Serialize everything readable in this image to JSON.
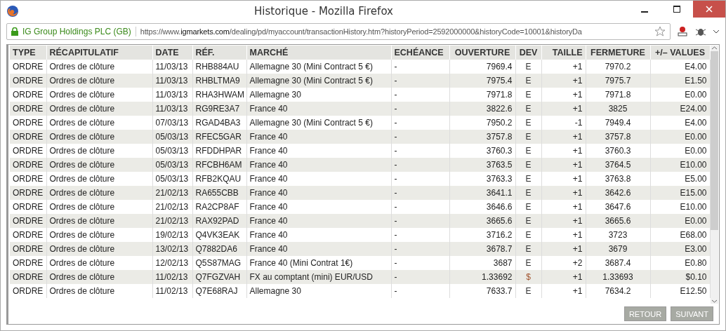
{
  "window": {
    "title": "Historique - Mozilla Firefox"
  },
  "address_bar": {
    "site_identity": "IG Group Holdings PLC (GB)",
    "url_prefix": "https://www.",
    "url_domain": "igmarkets.com",
    "url_path": "/dealing/pd/myaccount/transactionHistory.htm?historyPeriod=2592000000&historyCode=10001&historyDa"
  },
  "table": {
    "columns": [
      "TYPE",
      "RÉCAPITULATIF",
      "DATE",
      "RÉF.",
      "MARCHÉ",
      "ECHÉANCE",
      "OUVERTURE",
      "DEV",
      "TAILLE",
      "FERMETURE",
      "+/– VALUES"
    ],
    "rows": [
      {
        "cells": [
          "ORDRE",
          "Ordres de clôture",
          "11/03/13",
          "RHB884AU",
          "Allemagne 30 (Mini Contract 5 €)",
          "-",
          "7969.4",
          "E",
          "+1",
          "7970.2",
          "E4.00"
        ],
        "color": "#333333"
      },
      {
        "cells": [
          "ORDRE",
          "Ordres de clôture",
          "11/03/13",
          "RHBLTMA9",
          "Allemagne 30 (Mini Contract 5 €)",
          "-",
          "7975.4",
          "E",
          "+1",
          "7975.7",
          "E1.50"
        ],
        "color": "#333333"
      },
      {
        "cells": [
          "ORDRE",
          "Ordres de clôture",
          "11/03/13",
          "RHA3HWAM",
          "Allemagne 30",
          "-",
          "7971.8",
          "E",
          "+1",
          "7971.8",
          "E0.00"
        ],
        "color": "#333333"
      },
      {
        "cells": [
          "ORDRE",
          "Ordres de clôture",
          "11/03/13",
          "RG9RE3A7",
          "France 40",
          "-",
          "3822.6",
          "E",
          "+1",
          "3825",
          "E24.00"
        ],
        "color": "#333333"
      },
      {
        "cells": [
          "ORDRE",
          "Ordres de clôture",
          "07/03/13",
          "RGAD4BA3",
          "Allemagne 30 (Mini Contract 5 €)",
          "-",
          "7950.2",
          "E",
          "-1",
          "7949.4",
          "E4.00"
        ],
        "color": "#333333"
      },
      {
        "cells": [
          "ORDRE",
          "Ordres de clôture",
          "05/03/13",
          "RFEC5GAR",
          "France 40",
          "-",
          "3757.8",
          "E",
          "+1",
          "3757.8",
          "E0.00"
        ],
        "color": "#333333"
      },
      {
        "cells": [
          "ORDRE",
          "Ordres de clôture",
          "05/03/13",
          "RFDDHPAR",
          "France 40",
          "-",
          "3760.3",
          "E",
          "+1",
          "3760.3",
          "E0.00"
        ],
        "color": "#333333"
      },
      {
        "cells": [
          "ORDRE",
          "Ordres de clôture",
          "05/03/13",
          "RFCBH6AM",
          "France 40",
          "-",
          "3763.5",
          "E",
          "+1",
          "3764.5",
          "E10.00"
        ],
        "color": "#333333"
      },
      {
        "cells": [
          "ORDRE",
          "Ordres de clôture",
          "05/03/13",
          "RFB2KQAU",
          "France 40",
          "-",
          "3763.3",
          "E",
          "+1",
          "3763.8",
          "E5.00"
        ],
        "color": "#333333"
      },
      {
        "cells": [
          "ORDRE",
          "Ordres de clôture",
          "21/02/13",
          "RA655CBB",
          "France 40",
          "-",
          "3641.1",
          "E",
          "+1",
          "3642.6",
          "E15.00"
        ],
        "color": "#333333"
      },
      {
        "cells": [
          "ORDRE",
          "Ordres de clôture",
          "21/02/13",
          "RA2CP8AF",
          "France 40",
          "-",
          "3646.6",
          "E",
          "+1",
          "3647.6",
          "E10.00"
        ],
        "color": "#333333"
      },
      {
        "cells": [
          "ORDRE",
          "Ordres de clôture",
          "21/02/13",
          "RAX92PAD",
          "France 40",
          "-",
          "3665.6",
          "E",
          "+1",
          "3665.6",
          "E0.00"
        ],
        "color": "#333333"
      },
      {
        "cells": [
          "ORDRE",
          "Ordres de clôture",
          "19/02/13",
          "Q4VK3EAK",
          "France 40",
          "-",
          "3716.2",
          "E",
          "+1",
          "3723",
          "E68.00"
        ],
        "color": "#333333"
      },
      {
        "cells": [
          "ORDRE",
          "Ordres de clôture",
          "13/02/13",
          "Q7882DA6",
          "France 40",
          "-",
          "3678.7",
          "E",
          "+1",
          "3679",
          "E3.00"
        ],
        "color": "#333333"
      },
      {
        "cells": [
          "ORDRE",
          "Ordres de clôture",
          "12/02/13",
          "Q5S87MAG",
          "France 40 (Mini Contrat 1€)",
          "-",
          "3687",
          "E",
          "+2",
          "3687.4",
          "E0.80"
        ],
        "color": "#333333"
      },
      {
        "cells": [
          "ORDRE",
          "Ordres de clôture",
          "11/02/13",
          "Q7FGZVAH",
          "FX au comptant (mini) EUR/USD",
          "-",
          "1.33692",
          "$",
          "+1",
          "1.33693",
          "$0.10"
        ],
        "color": "#a0522d"
      },
      {
        "cells": [
          "ORDRE",
          "Ordres de clôture",
          "11/02/13",
          "Q7E68RAJ",
          "Allemagne 30",
          "-",
          "7633.7",
          "E",
          "+1",
          "7634.2",
          "E12.50"
        ],
        "color": "#333333"
      }
    ]
  },
  "buttons": [
    {
      "label": "RETOUR",
      "disabled": true
    },
    {
      "label": "SUIVANT",
      "disabled": true
    }
  ]
}
